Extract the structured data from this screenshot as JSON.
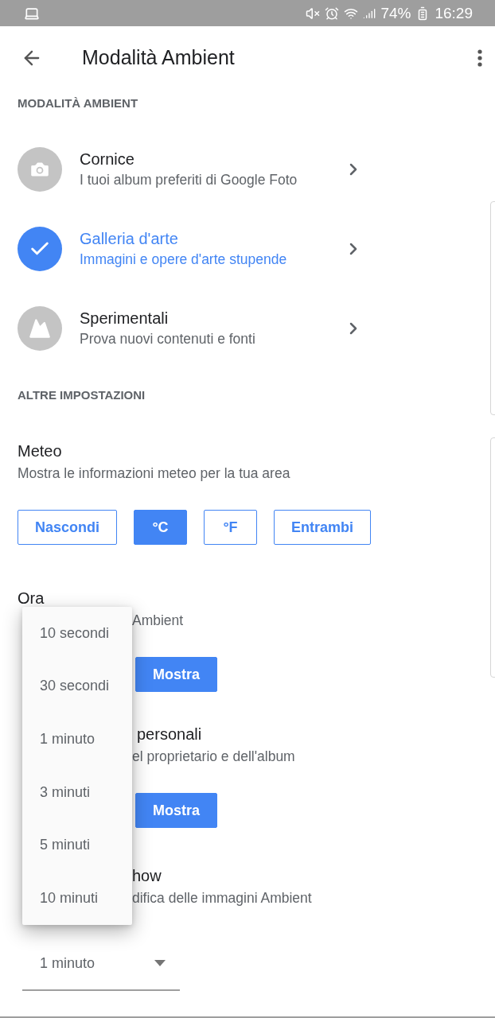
{
  "status_bar": {
    "battery": "74%",
    "time": "16:29"
  },
  "header": {
    "title": "Modalità Ambient"
  },
  "mode_section": {
    "heading": "MODALITÀ AMBIENT",
    "modes": [
      {
        "kind": "photo",
        "title": "Cornice",
        "subtitle": "I tuoi album preferiti di Google Foto",
        "selected": false
      },
      {
        "kind": "art",
        "title": "Galleria d'arte",
        "subtitle": "Immagini e opere d'arte stupende",
        "selected": true
      },
      {
        "kind": "landscape",
        "title": "Sperimentali",
        "subtitle": "Prova nuovi contenuti e fonti",
        "selected": false
      }
    ]
  },
  "other_section": {
    "heading": "ALTRE IMPOSTAZIONI",
    "settings": [
      {
        "title": "Meteo",
        "subtitle": "Mostra le informazioni meteo per la tua area",
        "options": [
          {
            "label": "Nascondi",
            "selected": false
          },
          {
            "label": "°C",
            "selected": true
          },
          {
            "label": "°F",
            "selected": false
          },
          {
            "label": "Entrambi",
            "selected": false
          }
        ]
      },
      {
        "title": "Ora",
        "subtitle": "Ambient",
        "options": [
          {
            "label": "Mostra",
            "selected": true
          }
        ]
      },
      {
        "title": "personali",
        "subtitle": "el proprietario e dell'album",
        "options": [
          {
            "label": "Mostra",
            "selected": true
          }
        ]
      },
      {
        "title": "how",
        "subtitle": "difica delle immagini Ambient"
      }
    ]
  },
  "select": {
    "value": "1 minuto"
  },
  "menu": {
    "items": [
      "10 secondi",
      "30 secondi",
      "1 minuto",
      "3 minuti",
      "5 minuti",
      "10 minuti"
    ]
  }
}
